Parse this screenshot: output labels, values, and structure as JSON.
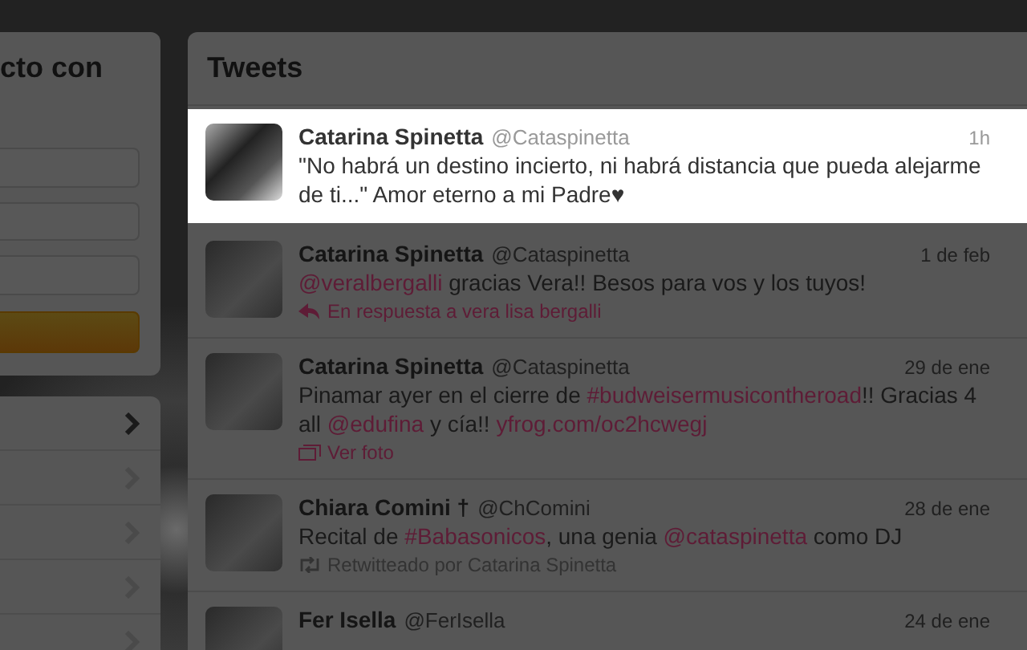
{
  "login_panel": {
    "title": "cto con"
  },
  "nav_items": [
    {
      "selected": true
    },
    {
      "selected": false
    },
    {
      "selected": false
    },
    {
      "selected": false
    },
    {
      "selected": false
    }
  ],
  "tweets_panel": {
    "title": "Tweets",
    "tweets": [
      {
        "name": "Catarina Spinetta",
        "handle": "@Cataspinetta",
        "time": "1h",
        "selected": true,
        "text": [
          {
            "kind": "plain",
            "text": "\"No habrá un destino incierto, ni habrá distancia que pueda alejarme de ti...\" Amor eterno a mi Padre♥"
          }
        ]
      },
      {
        "name": "Catarina Spinetta",
        "handle": "@Cataspinetta",
        "time": "1 de feb",
        "selected": false,
        "text": [
          {
            "kind": "link",
            "text": "@veralbergalli"
          },
          {
            "kind": "plain",
            "text": " gracias Vera!! Besos para vos y los tuyos!"
          }
        ],
        "context": {
          "kind": "reply",
          "text": "En respuesta a vera lisa bergalli"
        }
      },
      {
        "name": "Catarina Spinetta",
        "handle": "@Cataspinetta",
        "time": "29 de ene",
        "selected": false,
        "text": [
          {
            "kind": "plain",
            "text": "Pinamar ayer en el cierre de "
          },
          {
            "kind": "link",
            "text": "#budweisermusicontheroad"
          },
          {
            "kind": "plain",
            "text": "!! Gracias 4 all "
          },
          {
            "kind": "link",
            "text": "@edufina"
          },
          {
            "kind": "plain",
            "text": " y cía!! "
          },
          {
            "kind": "link",
            "text": "yfrog.com/oc2hcwegj"
          }
        ],
        "context": {
          "kind": "photo",
          "text": "Ver foto"
        }
      },
      {
        "name": "Chiara Comini †",
        "handle": "@ChComini",
        "time": "28 de ene",
        "selected": false,
        "text": [
          {
            "kind": "plain",
            "text": "Recital de "
          },
          {
            "kind": "link",
            "text": "#Babasonicos"
          },
          {
            "kind": "plain",
            "text": ", una genia "
          },
          {
            "kind": "link",
            "text": "@cataspinetta"
          },
          {
            "kind": "plain",
            "text": " como DJ"
          }
        ],
        "context": {
          "kind": "retweet",
          "text": "Retwitteado por Catarina Spinetta"
        }
      },
      {
        "name": "Fer Isella",
        "handle": "@FerIsella",
        "time": "24 de ene",
        "selected": false
      }
    ]
  }
}
